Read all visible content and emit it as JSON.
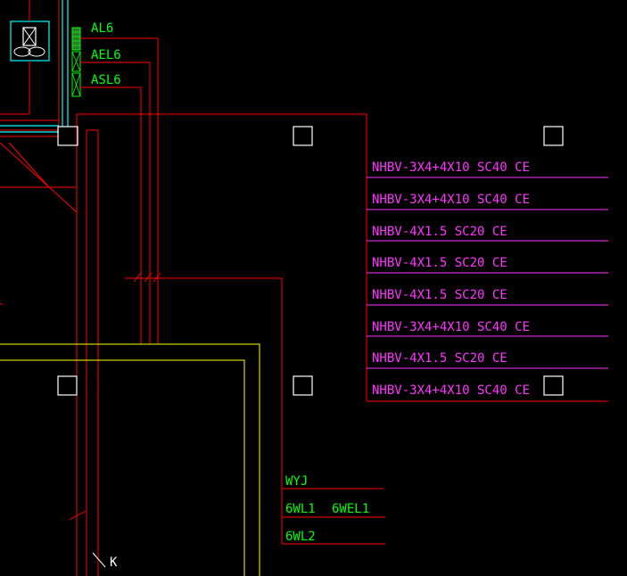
{
  "colors": {
    "background": "#000000",
    "red_wire": "#ff0000",
    "cyan": "#00ffff",
    "green_text": "#00ff00",
    "magenta_text": "#ff33ff",
    "yellow_wall": "#ffff00",
    "white": "#ffffff"
  },
  "panel_labels": [
    "AL6",
    "AEL6",
    "ASL6"
  ],
  "cable_schedule": [
    "NHBV-3X4+4X10 SC40 CE",
    "NHBV-3X4+4X10 SC40 CE",
    "NHBV-4X1.5 SC20 CE",
    "NHBV-4X1.5 SC20 CE",
    "NHBV-4X1.5 SC20 CE",
    "NHBV-3X4+4X10 SC40 CE",
    "NHBV-4X1.5 SC20 CE",
    "NHBV-3X4+4X10 SC40 CE"
  ],
  "circuit_labels": {
    "row1": "WYJ",
    "row2_a": "6WL1",
    "row2_b": "6WEL1",
    "row3": "6WL2"
  },
  "marker_letter": "K"
}
